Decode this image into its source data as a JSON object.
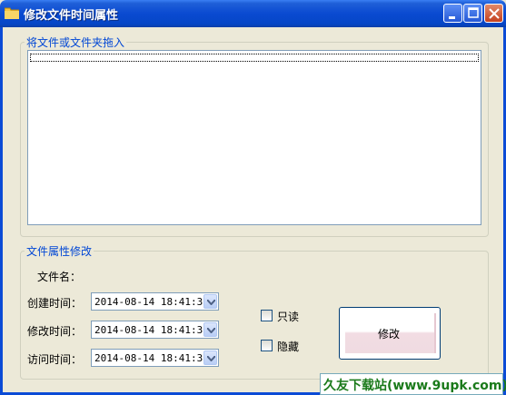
{
  "window": {
    "title": "修改文件时间属性",
    "controls": {
      "minimize": "minimize",
      "maximize": "maximize",
      "close": "close"
    }
  },
  "drop_group": {
    "legend": "将文件或文件夹拖入",
    "items": []
  },
  "attr_group": {
    "legend": "文件属性修改",
    "filename_label": "文件名：",
    "filename_value": "",
    "created_label": "创建时间：",
    "created_value": "2014-08-14 18:41:30",
    "modified_label": "修改时间：",
    "modified_value": "2014-08-14 18:41:30",
    "accessed_label": "访问时间：",
    "accessed_value": "2014-08-14 18:41:30",
    "readonly_label": "只读",
    "readonly_checked": false,
    "hidden_label": "隐藏",
    "hidden_checked": false,
    "modify_button": "修改"
  },
  "watermark": {
    "text": "久友下载站(www.9upk.com)"
  },
  "colors": {
    "accent": "#0046d5",
    "titlebar": "#0a4ad1",
    "face": "#ece9d8"
  }
}
